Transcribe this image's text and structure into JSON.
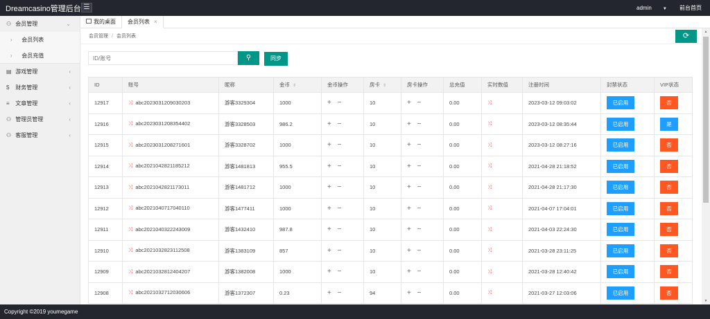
{
  "app": {
    "title": "Dreamcasino管理后台",
    "user": "admin",
    "frontpage": "前台首页"
  },
  "sidebar": {
    "items": [
      {
        "icon": "user-icon",
        "label": "会员管理",
        "expanded": true,
        "children": [
          {
            "label": "会员列表"
          },
          {
            "label": "会员充值"
          }
        ]
      },
      {
        "icon": "game-icon",
        "label": "游戏管理"
      },
      {
        "icon": "dollar-icon",
        "label": "财务管理"
      },
      {
        "icon": "list-icon",
        "label": "文章管理"
      },
      {
        "icon": "admin-icon",
        "label": "管理员管理"
      },
      {
        "icon": "service-icon",
        "label": "客服管理"
      }
    ]
  },
  "tabs": [
    {
      "label": "我的桌面",
      "icon": "home-icon"
    },
    {
      "label": "会员列表",
      "active": true,
      "close": "×"
    }
  ],
  "breadcrumb": {
    "parent": "会员管理",
    "separator": "/",
    "current": "会员列表"
  },
  "search": {
    "placeholder": "ID/账号",
    "sync_label": "同步"
  },
  "table": {
    "headers": [
      "ID",
      "账号",
      "昵称",
      "金币",
      "金币操作",
      "房卡",
      "房卡操作",
      "总充值",
      "实时数值",
      "注册时间",
      "封禁状态",
      "VIP状态"
    ],
    "rows": [
      {
        "id": "12917",
        "account": "abc2023031209030203",
        "nickname": "游客3329304",
        "coins": "1000",
        "op": "+ −",
        "cards": "10",
        "card_op": "+ −",
        "total": "0.00",
        "reg": "2023-03-12 09:03:02",
        "status": "已启用",
        "vip": "否",
        "vip_color": "#ff5722"
      },
      {
        "id": "12916",
        "account": "abc2023031208354402",
        "nickname": "游客3328503",
        "coins": "986.2",
        "op": "+ −",
        "cards": "10",
        "card_op": "+ −",
        "total": "0.00",
        "reg": "2023-03-12 08:35:44",
        "status": "已启用",
        "vip": "是",
        "vip_color": "#1e9fff"
      },
      {
        "id": "12915",
        "account": "abc2023031208271601",
        "nickname": "游客3328702",
        "coins": "1000",
        "op": "+ −",
        "cards": "10",
        "card_op": "+ −",
        "total": "0.00",
        "reg": "2023-03-12 08:27:16",
        "status": "已启用",
        "vip": "否",
        "vip_color": "#ff5722"
      },
      {
        "id": "12914",
        "account": "abc2021042821185212",
        "nickname": "游客1481813",
        "coins": "955.5",
        "op": "+ −",
        "cards": "10",
        "card_op": "+ −",
        "total": "0.00",
        "reg": "2021-04-28 21:18:52",
        "status": "已启用",
        "vip": "否",
        "vip_color": "#ff5722"
      },
      {
        "id": "12913",
        "account": "abc2021042821173011",
        "nickname": "游客1481712",
        "coins": "1000",
        "op": "+ −",
        "cards": "10",
        "card_op": "+ −",
        "total": "0.00",
        "reg": "2021-04-28 21:17:30",
        "status": "已启用",
        "vip": "否",
        "vip_color": "#ff5722"
      },
      {
        "id": "12912",
        "account": "abc2021040717040110",
        "nickname": "游客1477411",
        "coins": "1000",
        "op": "+ −",
        "cards": "10",
        "card_op": "+ −",
        "total": "0.00",
        "reg": "2021-04-07 17:04:01",
        "status": "已启用",
        "vip": "否",
        "vip_color": "#ff5722"
      },
      {
        "id": "12911",
        "account": "abc2021040322243009",
        "nickname": "游客1432410",
        "coins": "987.8",
        "op": "+ −",
        "cards": "10",
        "card_op": "+ −",
        "total": "0.00",
        "reg": "2021-04-03 22:24:30",
        "status": "已启用",
        "vip": "否",
        "vip_color": "#ff5722"
      },
      {
        "id": "12910",
        "account": "abc2021032823112508",
        "nickname": "游客1383109",
        "coins": "857",
        "op": "+ −",
        "cards": "10",
        "card_op": "+ −",
        "total": "0.00",
        "reg": "2021-03-28 23:11:25",
        "status": "已启用",
        "vip": "否",
        "vip_color": "#ff5722"
      },
      {
        "id": "12909",
        "account": "abc2021032812404207",
        "nickname": "游客1382008",
        "coins": "1000",
        "op": "+ −",
        "cards": "10",
        "card_op": "+ −",
        "total": "0.00",
        "reg": "2021-03-28 12:40:42",
        "status": "已启用",
        "vip": "否",
        "vip_color": "#ff5722"
      },
      {
        "id": "12908",
        "account": "abc2021032712030606",
        "nickname": "游客1372307",
        "coins": "0.23",
        "op": "+ −",
        "cards": "94",
        "card_op": "+ −",
        "total": "0.00",
        "reg": "2021-03-27 12:03:06",
        "status": "已启用",
        "vip": "否",
        "vip_color": "#ff5722"
      }
    ]
  },
  "footer": {
    "copyright": "Copyright ©2019 youmegame"
  },
  "colors": {
    "topbar": "#23262e",
    "primary": "#009688",
    "blue": "#1e9fff",
    "orange": "#ff5722"
  }
}
